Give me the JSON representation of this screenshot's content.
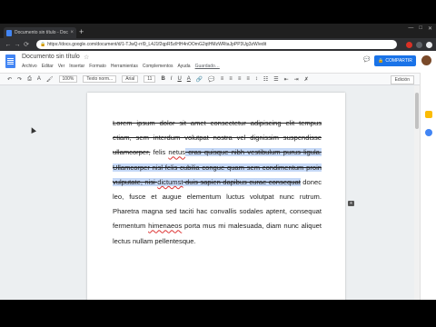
{
  "browser": {
    "tab_title": "Documento sin título - Docum",
    "tab_close": "×",
    "new_tab": "+",
    "url": "https://docs.google.com/document/d/1-TJwQ-rrI9_L4J1f2qpR5zIHH4nOOmG2qtHMzWRtaJpPP3Ug3zW/edit",
    "lock_glyph": "🔒",
    "back": "←",
    "forward": "→",
    "reload": "⟳"
  },
  "docs": {
    "title": "Documento sin título",
    "star": "☆",
    "menus": [
      "Archivo",
      "Editar",
      "Ver",
      "Insertar",
      "Formato",
      "Herramientas",
      "Complementos",
      "Ayuda"
    ],
    "saved_status": "Guardado…",
    "share_label": "COMPARTIR",
    "share_icon": "🔒",
    "bell_icon": "💬",
    "avatar_color": "#7a4a2a"
  },
  "toolbar": {
    "undo": "↶",
    "redo": "↷",
    "print": "⎙",
    "spell": "A",
    "paint": "🖌",
    "zoom": "100%",
    "style": "Texto norm...",
    "font": "Arial",
    "size": "11",
    "bold": "B",
    "italic": "I",
    "underline": "U",
    "text_color": "A",
    "link": "🔗",
    "comment": "💬",
    "align_left": "≡",
    "align_center": "≡",
    "align_right": "≡",
    "align_justify": "≡",
    "line_spacing": "↕",
    "numbered_list": "☷",
    "bulleted_list": "☰",
    "indent_less": "⇤",
    "indent_more": "⇥",
    "clear": "✗",
    "mode": "Edición",
    "collapse": "⌃"
  },
  "document": {
    "segments": [
      {
        "text": "Lorem ipsum dolor sit amet consectetur adipiscing elit tempus etiam, sem interdum volutpat nostra vel dignissim suspendisse ullamcorper,",
        "style": "strike"
      },
      {
        "text": " felis ",
        "style": "normal"
      },
      {
        "text": "netus",
        "style": "spell"
      },
      {
        "text": " cras quisque nibh vestibulum purus ligula. Ullamcorper nisl felis cubilia congue quam sem condimentum proin vulputate, nisi ",
        "style": "strike-hl"
      },
      {
        "text": "dictumst",
        "style": "strike-hl-spell"
      },
      {
        "text": " duis sapien dapibus curae consequat",
        "style": "strike-hl"
      },
      {
        "text": " donec leo, fusce et augue elementum luctus volutpat nunc rutrum. Pharetra magna sed taciti hac convallis sodales aptent, consequat fermentum ",
        "style": "normal"
      },
      {
        "text": "himenaeos",
        "style": "spell"
      },
      {
        "text": " porta mus mi malesuada, diam nunc aliquet lectus nullam pellentesque.",
        "style": "normal"
      }
    ]
  },
  "side": {
    "comment_add": "+",
    "explore": "✦"
  },
  "colors": {
    "selection": "#c6d9f7",
    "share": "#1a73e8",
    "docs_blue": "#4285f4"
  }
}
